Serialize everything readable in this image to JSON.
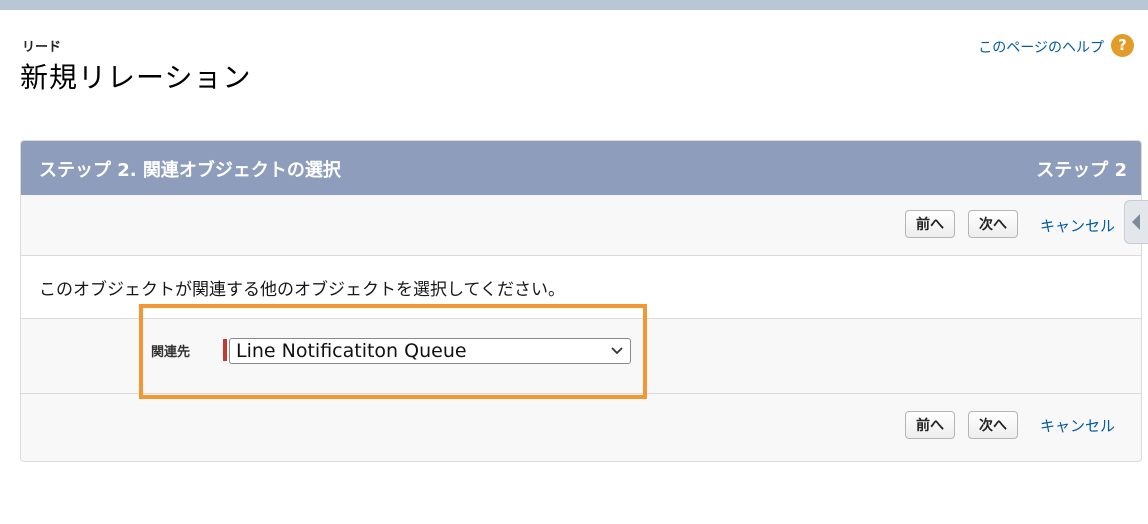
{
  "header": {
    "breadcrumb": "リード",
    "title": "新規リレーション",
    "help_link": "このページのヘルプ",
    "help_icon": "help-icon"
  },
  "panel": {
    "title": "ステップ 2. 関連オブジェクトの選択",
    "step": "ステップ 2",
    "buttons": {
      "prev": "前へ",
      "next": "次へ",
      "cancel": "キャンセル"
    },
    "instruction": "このオブジェクトが関連する他のオブジェクトを選択してください。",
    "field": {
      "label": "関連先",
      "value": "Line Notificatiton Queue"
    }
  },
  "colors": {
    "header_bg": "#8e9dbb",
    "link": "#015ba7",
    "highlight": "#f29733",
    "required": "#c23934"
  }
}
